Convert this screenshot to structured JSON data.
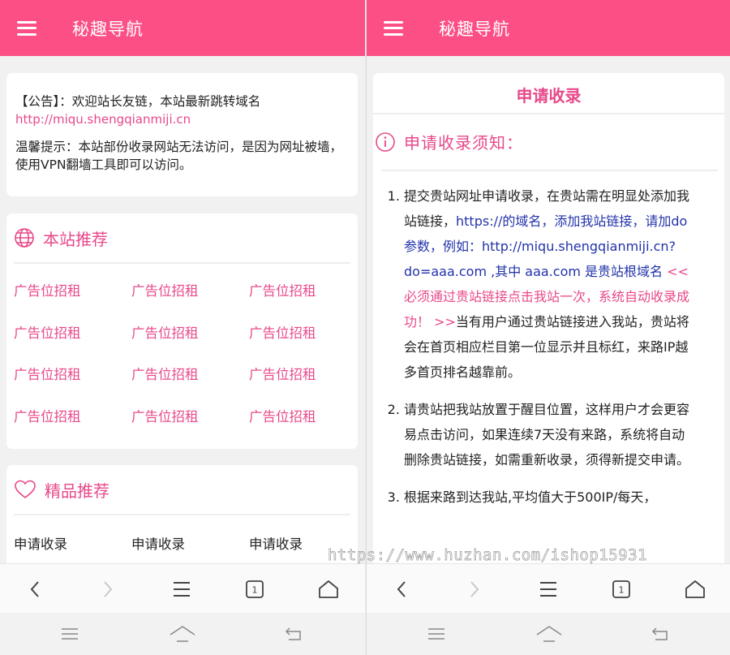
{
  "colors": {
    "accent": "#fc4f86",
    "link": "#e8488a",
    "blue": "#2233aa"
  },
  "left": {
    "title": "秘趣导航",
    "notice": {
      "line1": "【公告】：欢迎站长友链，本站最新跳转域名",
      "link": "http://miqu.shengqianmiji.cn",
      "tip": "温馨提示：本站部份收录网站无法访问，是因为网址被墙，使用VPN翻墙工具即可以访问。"
    },
    "recommend": {
      "title": "本站推荐",
      "items": [
        "广告位招租",
        "广告位招租",
        "广告位招租",
        "广告位招租",
        "广告位招租",
        "广告位招租",
        "广告位招租",
        "广告位招租",
        "广告位招租",
        "广告位招租",
        "广告位招租",
        "广告位招租"
      ]
    },
    "featured": {
      "title": "精品推荐",
      "items": [
        "申请收录",
        "申请收录",
        "申请收录"
      ]
    },
    "tab_count": "1"
  },
  "right": {
    "title": "秘趣导航",
    "card_title": "申请收录",
    "rules_title": "申请收录须知：",
    "rule1": {
      "a": "提交贵站网址申请收录，在贵站需在明显处添加我站链接，",
      "b": "https://的域名，添加我站链接，请加do参数，例如：http://miqu.shengqianmiji.cn?do=aaa.com ,其中 aaa.com 是贵站根域名",
      "c": " << 必须通过贵站链接点击我站一次，系统自动收录成功！ >>",
      "d": "当有用户通过贵站链接进入我站，贵站将会在首页相应栏目第一位显示并且标红，来路IP越多首页排名越靠前。"
    },
    "rule2": "请贵站把我站放置于醒目位置，这样用户才会更容易点击访问，如果连续7天没有来路，系统将自动删除贵站链接，如需重新收录，须得新提交申请。",
    "rule3": "根据来路到达我站,平均值大于500IP/每天，",
    "tab_count": "1"
  },
  "watermark": "https://www.huzhan.com/ishop15931",
  "icons": [
    "menu-icon",
    "globe-icon",
    "heart-icon",
    "info-icon",
    "back-icon",
    "forward-icon",
    "menu-lines-icon",
    "tabs-icon",
    "home-icon",
    "recent-apps-icon",
    "system-home-icon",
    "system-back-icon"
  ]
}
